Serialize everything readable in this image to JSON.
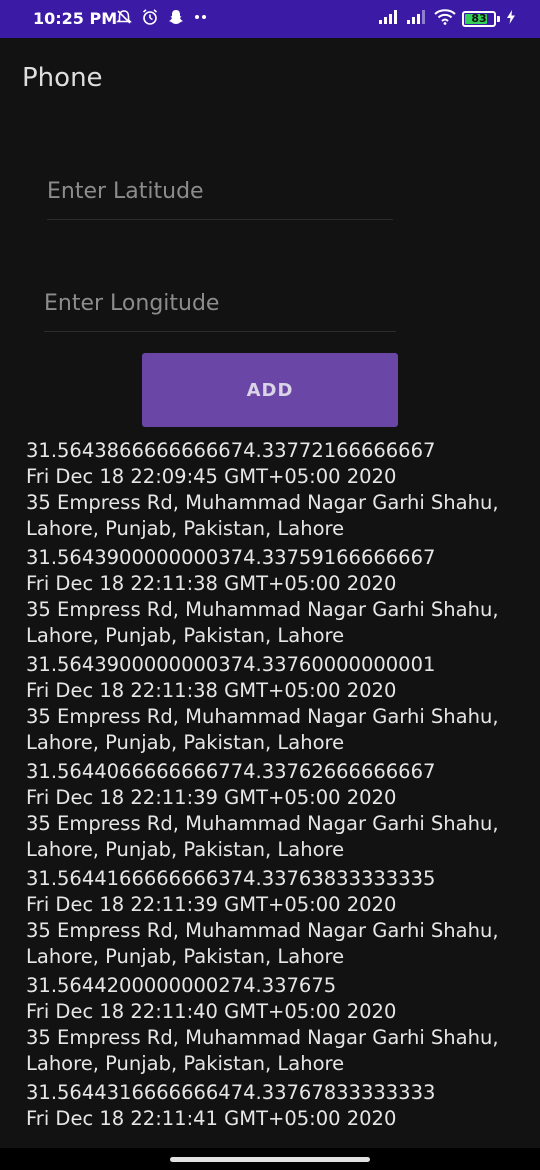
{
  "status_bar": {
    "time": "10:25 PM",
    "battery": "83",
    "icons_left": [
      "alarm-off-icon",
      "alarm-clock-icon",
      "snapchat-icon",
      "more-dots-icon"
    ],
    "icons_right": [
      "signal-icon",
      "signal-icon",
      "wifi-icon",
      "battery-icon",
      "charging-bolt-icon"
    ],
    "background": "#3b1aa5"
  },
  "app": {
    "title": "Phone"
  },
  "form": {
    "latitude_placeholder": "Enter Latitude",
    "latitude_value": "",
    "longitude_placeholder": "Enter Longitude",
    "longitude_value": "",
    "add_label": "ADD",
    "button_color": "#6a46a6"
  },
  "entries": [
    {
      "coords": "31.5643866666666674.33772166666667",
      "time": "Fri Dec 18 22:09:45 GMT+05:00 2020",
      "address": "35 Empress Rd, Muhammad Nagar Garhi Shahu, Lahore, Punjab, Pakistan,  Lahore"
    },
    {
      "coords": "31.5643900000000374.33759166666667",
      "time": "Fri Dec 18 22:11:38 GMT+05:00 2020",
      "address": "35 Empress Rd, Muhammad Nagar Garhi Shahu, Lahore, Punjab, Pakistan,  Lahore"
    },
    {
      "coords": "31.5643900000000374.33760000000001",
      "time": "Fri Dec 18 22:11:38 GMT+05:00 2020",
      "address": "35 Empress Rd, Muhammad Nagar Garhi Shahu, Lahore, Punjab, Pakistan,  Lahore"
    },
    {
      "coords": "31.5644066666666774.33762666666667",
      "time": "Fri Dec 18 22:11:39 GMT+05:00 2020",
      "address": "35 Empress Rd, Muhammad Nagar Garhi Shahu, Lahore, Punjab, Pakistan,  Lahore"
    },
    {
      "coords": "31.5644166666666374.33763833333335",
      "time": "Fri Dec 18 22:11:39 GMT+05:00 2020",
      "address": "35 Empress Rd, Muhammad Nagar Garhi Shahu, Lahore, Punjab, Pakistan,  Lahore"
    },
    {
      "coords": "31.5644200000000274.337675",
      "time": "Fri Dec 18 22:11:40 GMT+05:00 2020",
      "address": "35 Empress Rd, Muhammad Nagar Garhi Shahu, Lahore, Punjab, Pakistan,  Lahore"
    },
    {
      "coords": "31.5644316666666474.33767833333333",
      "time": "Fri Dec 18 22:11:41 GMT+05:00 2020",
      "address": ""
    }
  ]
}
